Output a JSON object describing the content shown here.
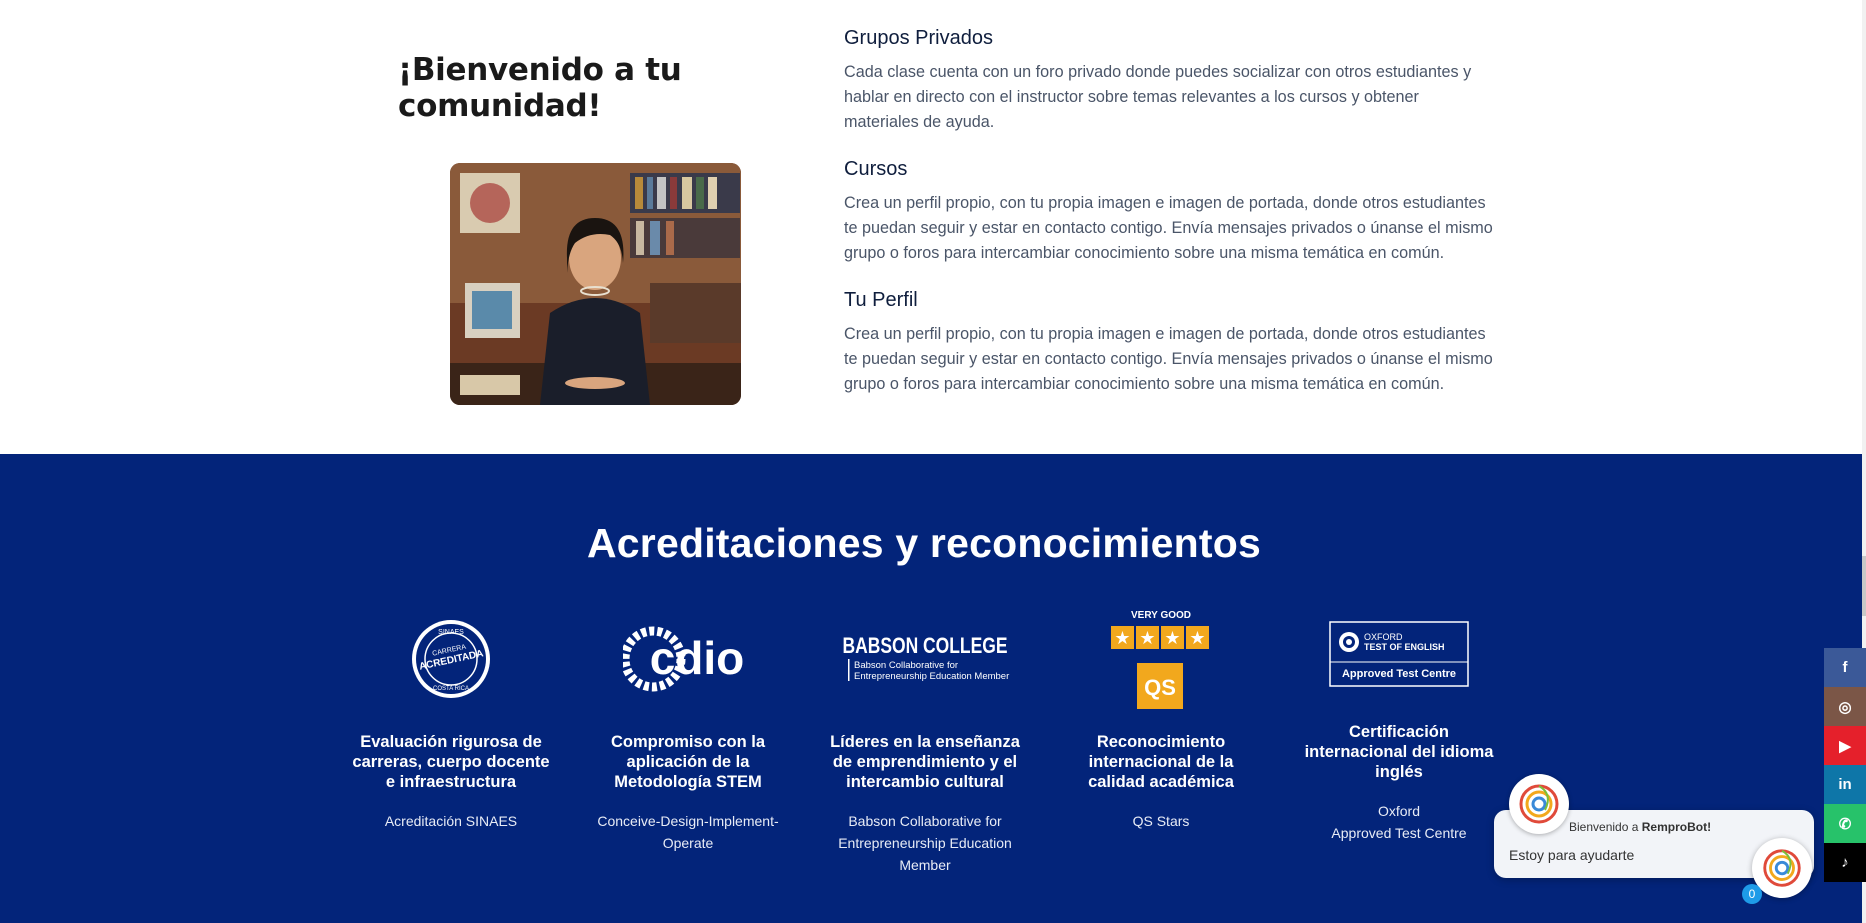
{
  "welcome": {
    "title": "¡Bienvenido a tu comunidad!"
  },
  "features": [
    {
      "title": "Grupos Privados",
      "text": "Cada clase cuenta con un foro privado donde puedes socializar con otros estudiantes y hablar en directo con el instructor sobre temas relevantes a los cursos y obtener materiales de ayuda."
    },
    {
      "title": "Cursos",
      "text": "Crea un perfil propio, con tu propia imagen e imagen de portada, donde otros estudiantes te puedan seguir y estar en contacto contigo. Envía mensajes privados o únanse el mismo grupo o foros para intercambiar conocimiento sobre una misma temática en común."
    },
    {
      "title": "Tu Perfil",
      "text": "Crea un perfil propio, con tu propia imagen e imagen de portada, donde otros estudiantes te puedan seguir y estar en contacto contigo. Envía mensajes privados o únanse el mismo grupo o foros para intercambiar conocimiento sobre una misma temática en común."
    }
  ],
  "accreditations": {
    "title": "Acreditaciones y reconocimientos",
    "items": [
      {
        "logo": "sinaes-seal",
        "logo_text_top": "SINAES",
        "logo_text_mid1": "CARRERA",
        "logo_text_mid2": "ACREDITADA",
        "logo_text_bottom": "COSTA RICA",
        "heading": "Evaluación rigurosa de carreras, cuerpo docente e infraestructura",
        "source": "Acreditación SINAES"
      },
      {
        "logo": "cdio-logo",
        "logo_text": "cdio",
        "heading": "Compromiso con la aplicación de la Metodología STEM",
        "source": "Conceive-Design-Implement-Operate"
      },
      {
        "logo": "babson-logo",
        "logo_text": "BABSON COLLEGE",
        "logo_sub1": "Babson Collaborative for",
        "logo_sub2": "Entrepreneurship Education Member",
        "heading": "Líderes en la enseñanza de emprendimiento y el intercambio cultural",
        "source": "Babson Collaborative for Entrepreneurship Education Member"
      },
      {
        "logo": "qs-stars-logo",
        "logo_text_top": "VERY GOOD",
        "logo_text": "QS",
        "stars": 4,
        "heading": "Reconocimiento internacional de la calidad académica",
        "source": "QS Stars"
      },
      {
        "logo": "oxford-logo",
        "logo_text1": "OXFORD",
        "logo_text2": "TEST OF ENGLISH",
        "logo_text3": "Approved Test Centre",
        "heading": "Certificación internacional del idioma inglés",
        "source1": "Oxford",
        "source2": "Approved Test Centre"
      }
    ]
  },
  "social": [
    {
      "icon": "facebook-icon",
      "glyph": "f",
      "color": "#3b5998"
    },
    {
      "icon": "instagram-icon",
      "glyph": "◎",
      "color": "#7b5647"
    },
    {
      "icon": "youtube-icon",
      "glyph": "▶",
      "color": "#e5202b"
    },
    {
      "icon": "linkedin-icon",
      "glyph": "in",
      "color": "#0e76a8"
    },
    {
      "icon": "whatsapp-icon",
      "glyph": "✆",
      "color": "#27c26a"
    },
    {
      "icon": "tiktok-icon",
      "glyph": "♪",
      "color": "#000000"
    }
  ],
  "chatbot": {
    "welcome_prefix": "Bienvenido a ",
    "bot_name": "RemproBot!",
    "message": "Estoy para ayudarte",
    "badge": "0"
  },
  "colors": {
    "navy": "#03247a",
    "gold": "#f2a81d"
  }
}
